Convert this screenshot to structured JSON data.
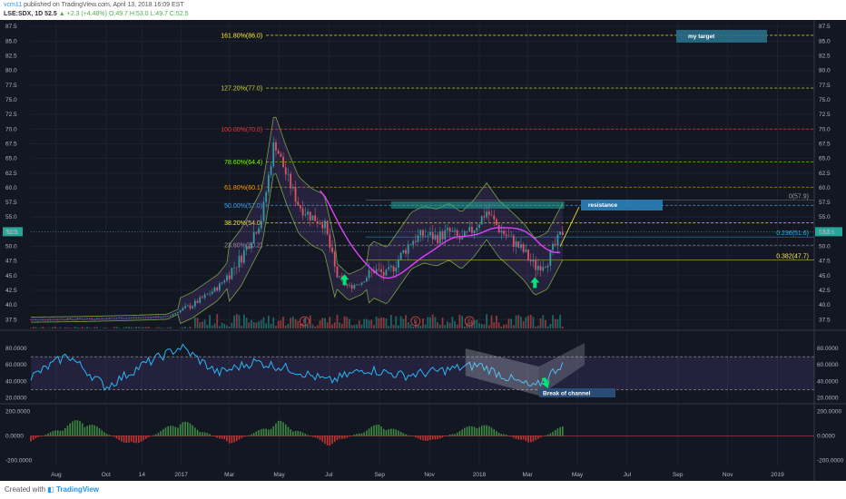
{
  "header": {
    "user": "vcm11",
    "publish": "published on TradingView.com, April 13, 2018 16:09 EST",
    "symbol": "LSE:SDX, 1D",
    "last": "52.5",
    "change": "+2.3 (+4.48%)",
    "ohlc": "O:49.7 H:53.0 L:49.7 C:52.5"
  },
  "footer": {
    "created_with": "Created with",
    "brand": "TradingView"
  },
  "colors": {
    "background": "#131722",
    "up": "#26a69a",
    "down": "#ef5350",
    "rsi_line": "#29b6f6",
    "ma_line": "#e040fb",
    "bollinger": "#8bc34a",
    "annotation_box": "#2a6f8a"
  },
  "annotations": {
    "my_target": "my target",
    "resistance": "resistance",
    "break_of_channel": "Break of channel",
    "event_marker": "E"
  },
  "chart_data": [
    {
      "type": "candlestick",
      "panel": "price",
      "x_axis_labels": [
        "Aug",
        "Oct",
        "14",
        "2017",
        "Mar",
        "May",
        "Jul",
        "Sep",
        "Nov",
        "2018",
        "Mar",
        "May",
        "Jul",
        "Sep",
        "Nov",
        "2019"
      ],
      "y_tick_labels": [
        "87.5",
        "85.0",
        "82.5",
        "80.0",
        "77.5",
        "75.0",
        "72.5",
        "70.0",
        "67.5",
        "65.0",
        "62.5",
        "60.0",
        "57.5",
        "55.0",
        "52.5",
        "50.0",
        "47.5",
        "45.0",
        "42.5",
        "40.0",
        "37.5"
      ],
      "ylim": [
        36,
        88
      ],
      "last_price_label": "52.5",
      "fib_extension_levels": [
        {
          "label": "161.80%(86.0)",
          "value": 86.0,
          "color": "#ffeb3b"
        },
        {
          "label": "127.20%(77.0)",
          "value": 77.0,
          "color": "#cddc39"
        },
        {
          "label": "100.00%(70.0)",
          "value": 70.0,
          "color": "#e53935"
        },
        {
          "label": "78.60%(64.4)",
          "value": 64.4,
          "color": "#76ff03"
        },
        {
          "label": "61.80%(60.1)",
          "value": 60.1,
          "color": "#ff9800"
        },
        {
          "label": "50.00%(57.0)",
          "value": 57.0,
          "color": "#42a5f5"
        },
        {
          "label": "38.20%(54.0)",
          "value": 54.0,
          "color": "#ffeb3b"
        },
        {
          "label": "23.60%(50.2)",
          "value": 50.2,
          "color": "#9e9e9e"
        }
      ],
      "fib_retracement_levels": [
        {
          "label": "0(57.9)",
          "value": 57.9,
          "color": "#9e9e9e"
        },
        {
          "label": "0.236(51.6)",
          "value": 51.6,
          "color": "#29b6f6"
        },
        {
          "label": "0.382(47.7)",
          "value": 47.7,
          "color": "#ffeb3b"
        }
      ],
      "series": [
        {
          "name": "close",
          "x": [
            "2016-07-01",
            "2016-09-01",
            "2016-11-01",
            "2016-12-15",
            "2017-01-15",
            "2017-02-15",
            "2017-03-15",
            "2017-04-10",
            "2017-04-25",
            "2017-05-10",
            "2017-05-25",
            "2017-06-10",
            "2017-06-25",
            "2017-07-10",
            "2017-07-25",
            "2017-08-10",
            "2017-08-25",
            "2017-09-10",
            "2017-09-25",
            "2017-10-10",
            "2017-10-25",
            "2017-11-10",
            "2017-11-25",
            "2017-12-10",
            "2017-12-25",
            "2018-01-10",
            "2018-01-25",
            "2018-02-10",
            "2018-02-25",
            "2018-03-10",
            "2018-03-25",
            "2018-04-13"
          ],
          "values": [
            37.5,
            37.6,
            37.8,
            38.0,
            40.0,
            43.0,
            48.0,
            55.0,
            68.0,
            62.0,
            57.0,
            55.0,
            54.0,
            45.0,
            43.0,
            44.0,
            46.0,
            45.0,
            48.0,
            51.0,
            52.0,
            51.5,
            52.5,
            51.0,
            53.0,
            56.0,
            53.0,
            51.0,
            49.0,
            46.5,
            47.5,
            52.5
          ]
        }
      ]
    },
    {
      "type": "line",
      "panel": "rsi",
      "y_tick_labels": [
        "80.0000",
        "60.0000",
        "40.0000",
        "20.0000"
      ],
      "ylim": [
        15,
        100
      ],
      "series": [
        {
          "name": "RSI",
          "x": [
            "2016-07-01",
            "2016-08-15",
            "2016-10-01",
            "2016-11-15",
            "2017-01-01",
            "2017-02-15",
            "2017-04-01",
            "2017-05-15",
            "2017-07-01",
            "2017-08-15",
            "2017-10-01",
            "2017-11-15",
            "2018-01-01",
            "2018-02-15",
            "2018-03-10",
            "2018-04-13"
          ],
          "values": [
            45,
            72,
            33,
            60,
            82,
            50,
            64,
            55,
            40,
            55,
            47,
            53,
            60,
            40,
            32,
            62
          ]
        }
      ]
    },
    {
      "type": "bar",
      "panel": "oscillator",
      "y_tick_labels": [
        "200.0000",
        "0.0000",
        "-200.0000"
      ],
      "ylim": [
        -250,
        250
      ],
      "series": [
        {
          "name": "oscillator",
          "x": [
            "2016-07-01",
            "2016-09-01",
            "2016-11-01",
            "2017-01-01",
            "2017-03-01",
            "2017-05-01",
            "2017-07-01",
            "2017-09-01",
            "2017-11-01",
            "2018-01-01",
            "2018-03-01",
            "2018-04-13"
          ],
          "values": [
            -40,
            130,
            -80,
            120,
            -60,
            110,
            -70,
            90,
            -50,
            100,
            -60,
            70
          ]
        }
      ]
    }
  ]
}
